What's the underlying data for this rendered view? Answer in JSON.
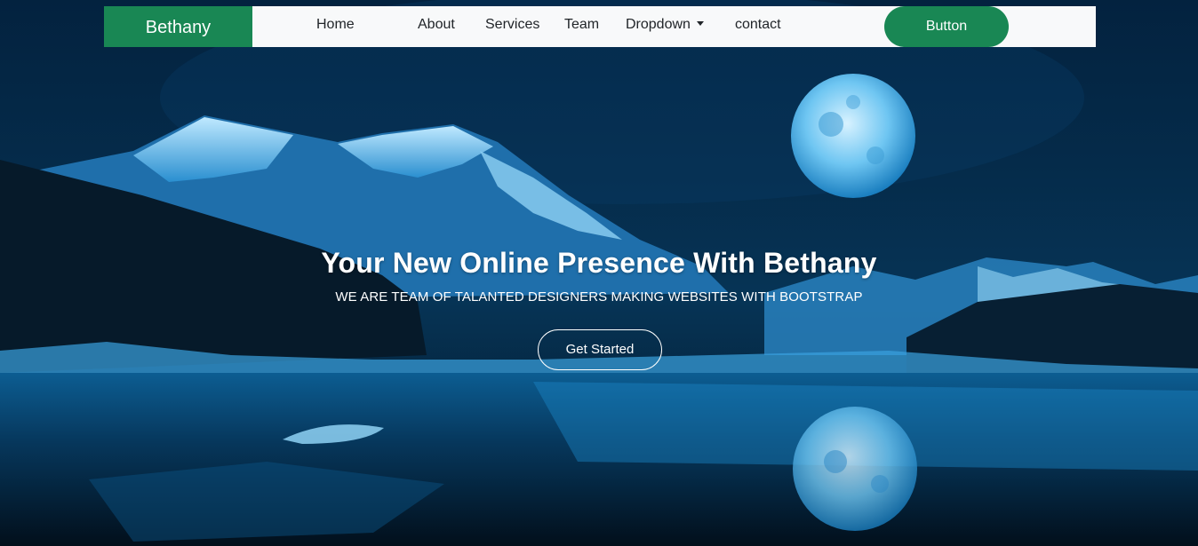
{
  "navbar": {
    "brand": "Bethany",
    "links": [
      {
        "label": "Home"
      },
      {
        "label": "About"
      },
      {
        "label": "Services"
      },
      {
        "label": "Team"
      },
      {
        "label": "Dropdown"
      },
      {
        "label": "contact"
      }
    ],
    "button_label": "Button"
  },
  "hero": {
    "title": "Your New Online Presence With Bethany",
    "subtitle": "WE ARE TEAM OF TALANTED DESIGNERS MAKING WEBSITES WITH BOOTSTRAP",
    "cta_label": "Get Started"
  },
  "colors": {
    "brand_green": "#198754",
    "navbar_bg": "#f8f9fa",
    "night_sky": "#03223f"
  }
}
